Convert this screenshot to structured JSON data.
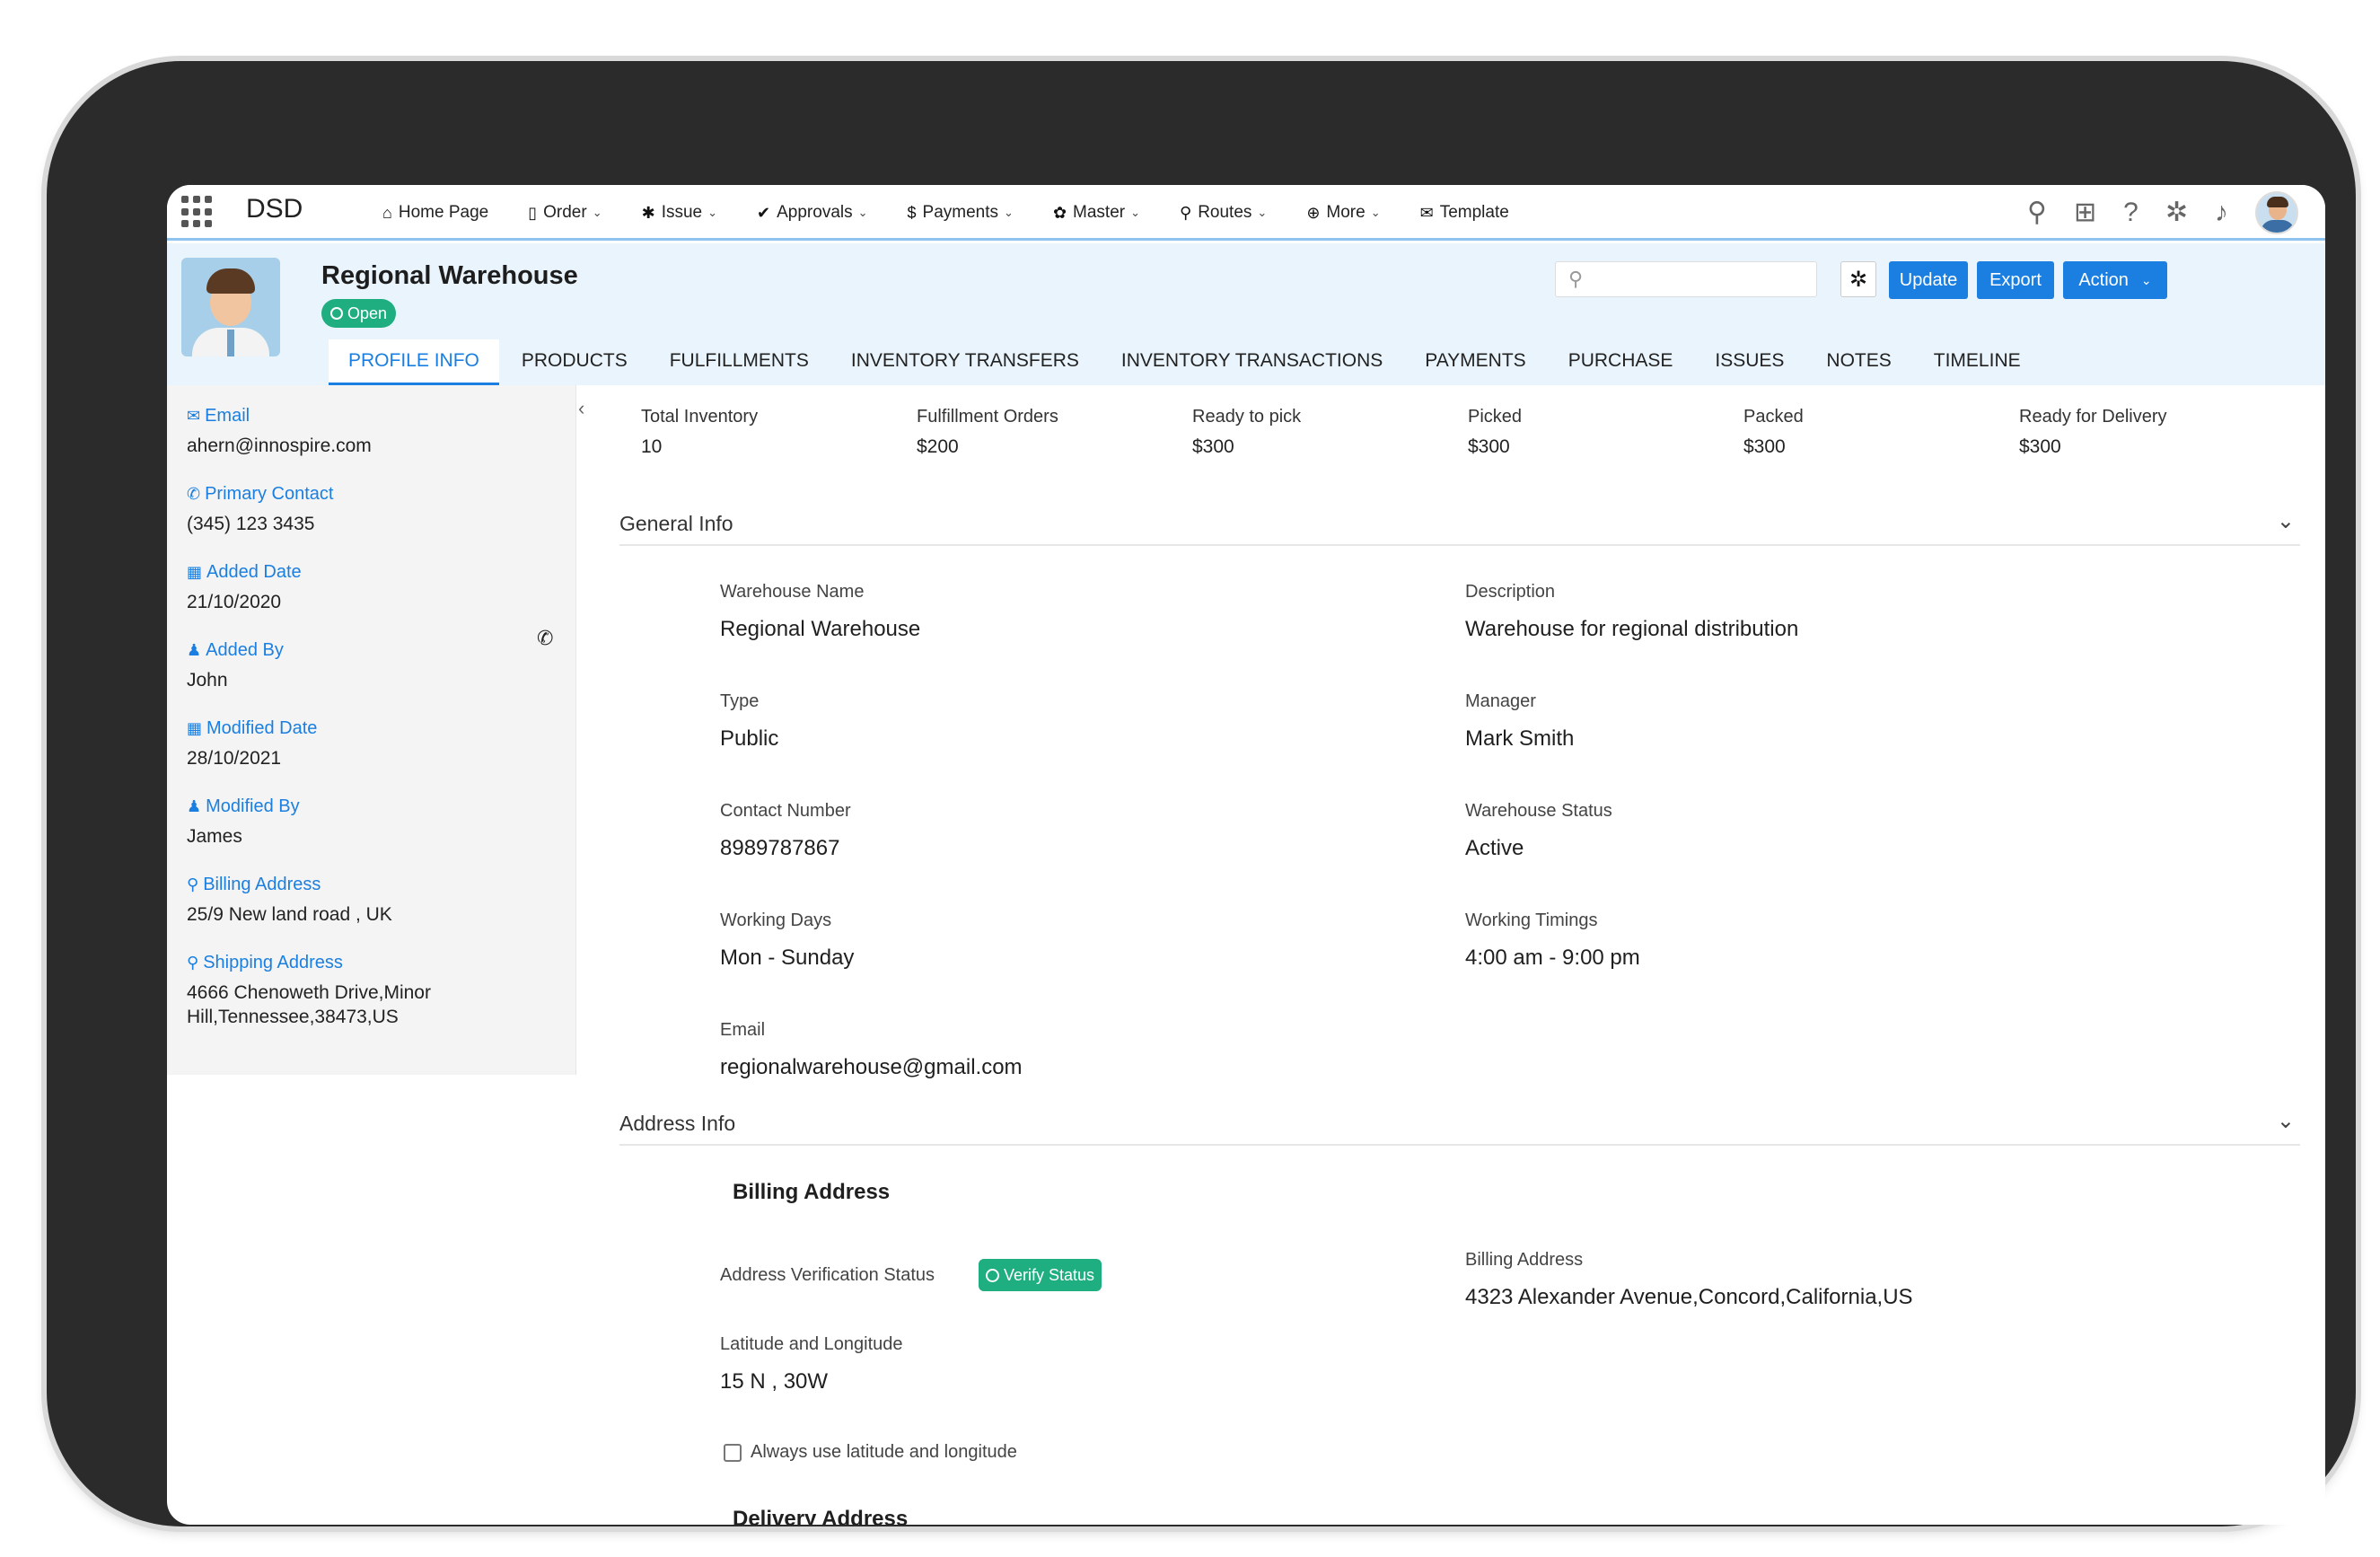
{
  "nav": {
    "brand": "DSD",
    "items": [
      {
        "label": "Home Page",
        "icon": "home-icon",
        "glyph": "⌂",
        "has_dropdown": false
      },
      {
        "label": "Order",
        "icon": "document-icon",
        "glyph": "▯",
        "has_dropdown": true
      },
      {
        "label": "Issue",
        "icon": "bug-icon",
        "glyph": "✱",
        "has_dropdown": true
      },
      {
        "label": "Approvals",
        "icon": "check-icon",
        "glyph": "✔",
        "has_dropdown": true
      },
      {
        "label": "Payments",
        "icon": "dollar-icon",
        "glyph": "$",
        "has_dropdown": true
      },
      {
        "label": "Master",
        "icon": "gear-icon",
        "glyph": "✿",
        "has_dropdown": true
      },
      {
        "label": "Routes",
        "icon": "map-marker-icon",
        "glyph": "⚲",
        "has_dropdown": true
      },
      {
        "label": "More",
        "icon": "plus-circle-icon",
        "glyph": "⊕",
        "has_dropdown": true
      },
      {
        "label": "Template",
        "icon": "envelope-icon",
        "glyph": "✉",
        "has_dropdown": false
      }
    ],
    "right_icons": [
      "search-icon",
      "add-square-icon",
      "help-icon",
      "settings-icon",
      "bell-icon",
      "user-avatar"
    ]
  },
  "record": {
    "title": "Regional Warehouse",
    "status": "Open",
    "search_placeholder": "",
    "buttons": {
      "update": "Update",
      "export": "Export",
      "action": "Action"
    }
  },
  "tabs": [
    "PROFILE INFO",
    "PRODUCTS",
    "FULFILLMENTS",
    "INVENTORY TRANSFERS",
    "INVENTORY TRANSACTIONS",
    "PAYMENTS",
    "PURCHASE",
    "ISSUES",
    "NOTES",
    "TIMELINE"
  ],
  "active_tab": "PROFILE INFO",
  "sidebar": {
    "fields": [
      {
        "label": "Email",
        "icon": "envelope-icon",
        "value": "ahern@innospire.com"
      },
      {
        "label": "Primary Contact",
        "icon": "phone-icon",
        "value": "(345) 123 3435"
      },
      {
        "label": "Added Date",
        "icon": "calendar-icon",
        "value": "21/10/2020"
      },
      {
        "label": "Added By",
        "icon": "user-icon",
        "value": "John"
      },
      {
        "label": "Modified Date",
        "icon": "calendar-icon",
        "value": "28/10/2021"
      },
      {
        "label": "Modified By",
        "icon": "user-icon",
        "value": "James"
      },
      {
        "label": "Billing Address",
        "icon": "map-marker-icon",
        "value": "25/9 New land road , UK"
      },
      {
        "label": "Shipping Address",
        "icon": "map-marker-icon",
        "value_line1": "4666 Chenoweth Drive,Minor",
        "value_line2": "Hill,Tennessee,38473,US"
      }
    ]
  },
  "stats": [
    {
      "label": "Total Inventory",
      "value": "10"
    },
    {
      "label": "Fulfillment Orders",
      "value": "$200"
    },
    {
      "label": "Ready to pick",
      "value": "$300"
    },
    {
      "label": "Picked",
      "value": "$300"
    },
    {
      "label": "Packed",
      "value": "$300"
    },
    {
      "label": "Ready for Delivery",
      "value": "$300"
    }
  ],
  "general_info": {
    "title": "General Info",
    "fields": {
      "warehouse_name": {
        "label": "Warehouse Name",
        "value": "Regional Warehouse"
      },
      "description": {
        "label": "Description",
        "value": "Warehouse for regional distribution"
      },
      "type": {
        "label": "Type",
        "value": "Public"
      },
      "manager": {
        "label": "Manager",
        "value": "Mark Smith"
      },
      "contact_number": {
        "label": "Contact Number",
        "value": "8989787867"
      },
      "warehouse_status": {
        "label": "Warehouse Status",
        "value": "Active"
      },
      "working_days": {
        "label": "Working Days",
        "value": "Mon - Sunday"
      },
      "working_timings": {
        "label": "Working Timings",
        "value": "4:00 am - 9:00 pm"
      },
      "email": {
        "label": "Email",
        "value": "regionalwarehouse@gmail.com"
      }
    }
  },
  "address_info": {
    "title": "Address Info",
    "billing_heading": "Billing Address",
    "verification_label": "Address Verification Status",
    "verify_button": "Verify Status",
    "billing_label": "Billing Address",
    "billing_value": "4323 Alexander Avenue,Concord,California,US",
    "latlong_label": "Latitude and Longitude",
    "latlong_value": "15 N , 30W",
    "always_use_label": "Always use latitude and longitude",
    "delivery_heading": "Delivery Address"
  }
}
